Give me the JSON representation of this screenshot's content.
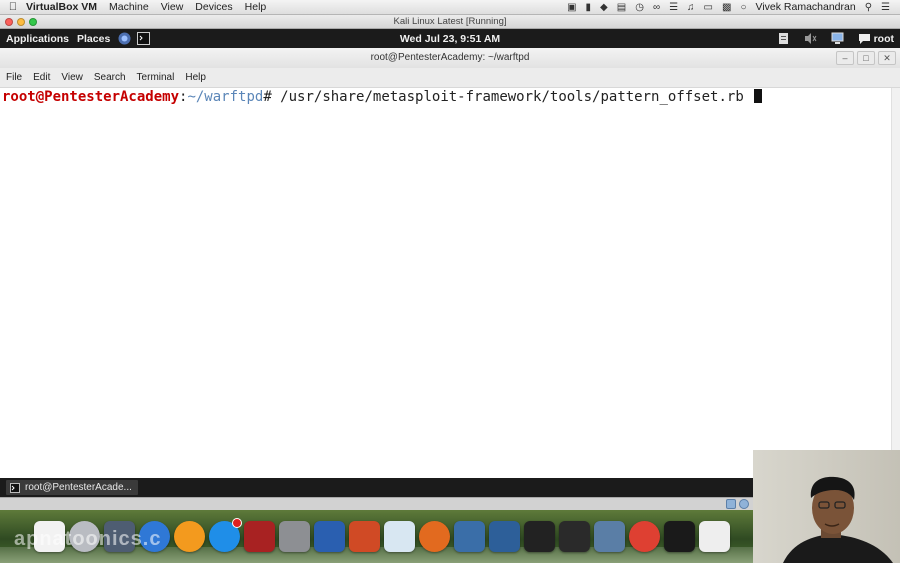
{
  "mac_menubar": {
    "app_name": "VirtualBox VM",
    "menus": [
      "Machine",
      "View",
      "Devices",
      "Help"
    ],
    "user_name": "Vivek Ramachandran"
  },
  "vbox_window": {
    "title": "Kali Linux Latest [Running]"
  },
  "kali_panel": {
    "applications": "Applications",
    "places": "Places",
    "clock": "Wed Jul 23,  9:51 AM",
    "user": "root"
  },
  "terminal": {
    "title": "root@PentesterAcademy: ~/warftpd",
    "menus": [
      "File",
      "Edit",
      "View",
      "Search",
      "Terminal",
      "Help"
    ],
    "prompt_user_host": "root@PentesterAcademy",
    "prompt_sep": ":",
    "prompt_path": "~/warftpd",
    "prompt_symbol": "#",
    "command": " /usr/share/metasploit-framework/tools/pattern_offset.rb "
  },
  "taskbar": {
    "item_label": "root@PentesterAcade..."
  },
  "dock": {
    "watermark": "apnatoonics.c",
    "apps": [
      {
        "name": "preview",
        "color": "#f2f2f2"
      },
      {
        "name": "launchpad",
        "color": "#b9bcc2"
      },
      {
        "name": "finder-app",
        "color": "#4e5d72"
      },
      {
        "name": "itunes",
        "color": "#2f78d6"
      },
      {
        "name": "ibooks",
        "color": "#f39a1e"
      },
      {
        "name": "app-store",
        "color": "#1f8ee8"
      },
      {
        "name": "photo-booth",
        "color": "#a82222"
      },
      {
        "name": "system-preferences",
        "color": "#8d8f93"
      },
      {
        "name": "word",
        "color": "#2a5fb0"
      },
      {
        "name": "powerpoint",
        "color": "#d04a25"
      },
      {
        "name": "preview-doc",
        "color": "#d8e7f2"
      },
      {
        "name": "firefox",
        "color": "#e26a1f"
      },
      {
        "name": "virtualbox",
        "color": "#3a6ea8"
      },
      {
        "name": "virtualbox-2",
        "color": "#2d5f99"
      },
      {
        "name": "window-thumb",
        "color": "#222222"
      },
      {
        "name": "window-thumb-2",
        "color": "#2a2a2a"
      },
      {
        "name": "imovie",
        "color": "#5a7ea6"
      },
      {
        "name": "chrome",
        "color": "#de4032"
      },
      {
        "name": "terminal-app",
        "color": "#1a1a1a"
      },
      {
        "name": "sheep-app",
        "color": "#eeeeee"
      }
    ]
  }
}
